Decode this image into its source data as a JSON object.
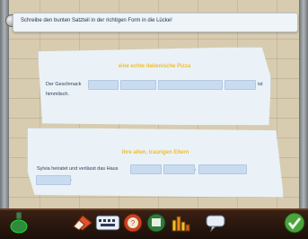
{
  "instruction": "Schreibe den bunten Satzteil in der richtigen Form in die Lücke!",
  "cards": [
    {
      "title": "eine echte italienische Pizza",
      "text_start": "Der Geschmack",
      "text_end": "ist",
      "text_line2": "himmlisch."
    },
    {
      "title": "ihre alten, traurigen Eltern",
      "text_start": "Sylvia heiratet und verlässt das Haus",
      "separator": ",",
      "text_end": "."
    }
  ],
  "taskbar": {
    "icons": [
      "potion-icon",
      "eraser-icon",
      "keyboard-icon",
      "help-icon",
      "stamp-icon",
      "statistics-icon",
      "speech-bubble-icon",
      "check-icon"
    ]
  }
}
